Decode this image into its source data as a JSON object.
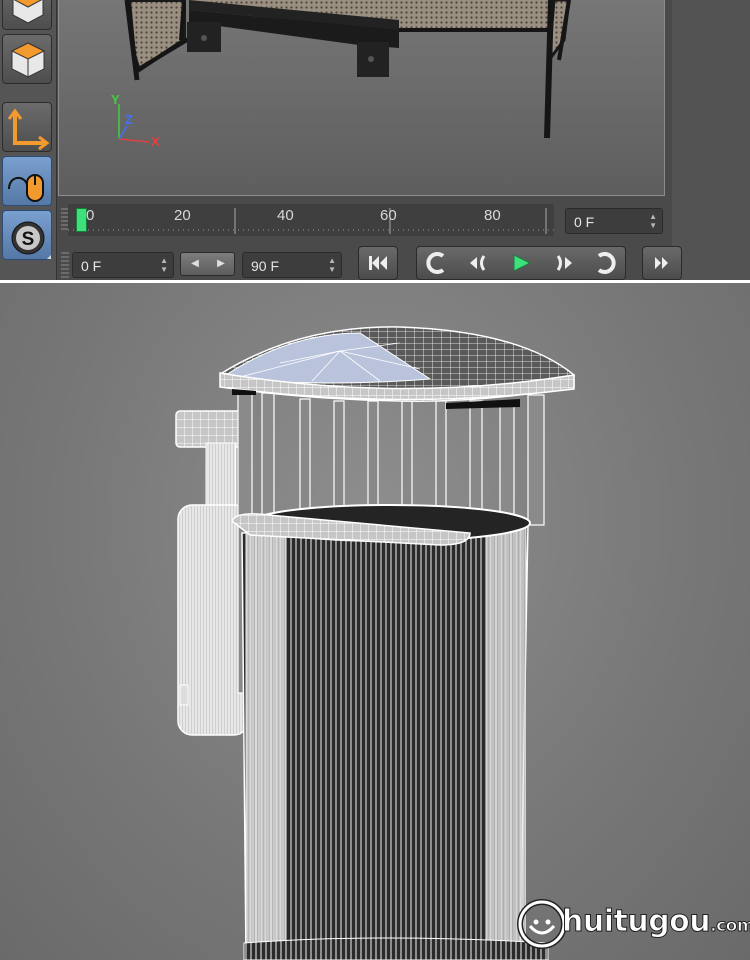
{
  "toolbar": {
    "items": [
      {
        "icon": "cube-icon"
      },
      {
        "icon": "cube-icon"
      },
      {
        "icon": "axis-tool-icon"
      },
      {
        "icon": "mouse-tool-icon",
        "active": true
      },
      {
        "icon": "snap-icon"
      }
    ]
  },
  "viewport": {
    "axes": {
      "y": "Y",
      "z": "Z",
      "x": "X"
    }
  },
  "timeline": {
    "ticks": [
      "0",
      "20",
      "40",
      "60",
      "80"
    ],
    "current_frame_field": "0 F"
  },
  "transport": {
    "start_field": "0 F",
    "end_field": "90 F",
    "buttons": {
      "go_start": "go-to-start-icon",
      "prev_key": "previous-key-icon",
      "prev_frame": "previous-frame-icon",
      "play": "play-icon",
      "next_frame": "next-frame-icon",
      "next_key": "next-key-icon",
      "more": "more-icon"
    }
  },
  "watermark": {
    "text": "huitugou",
    "suffix": ".com"
  },
  "colors": {
    "accent_blue": "#5578a6",
    "playhead_green": "#3ee07a",
    "axis_x": "#e04040",
    "axis_y": "#40d040",
    "axis_z": "#4070ff"
  }
}
